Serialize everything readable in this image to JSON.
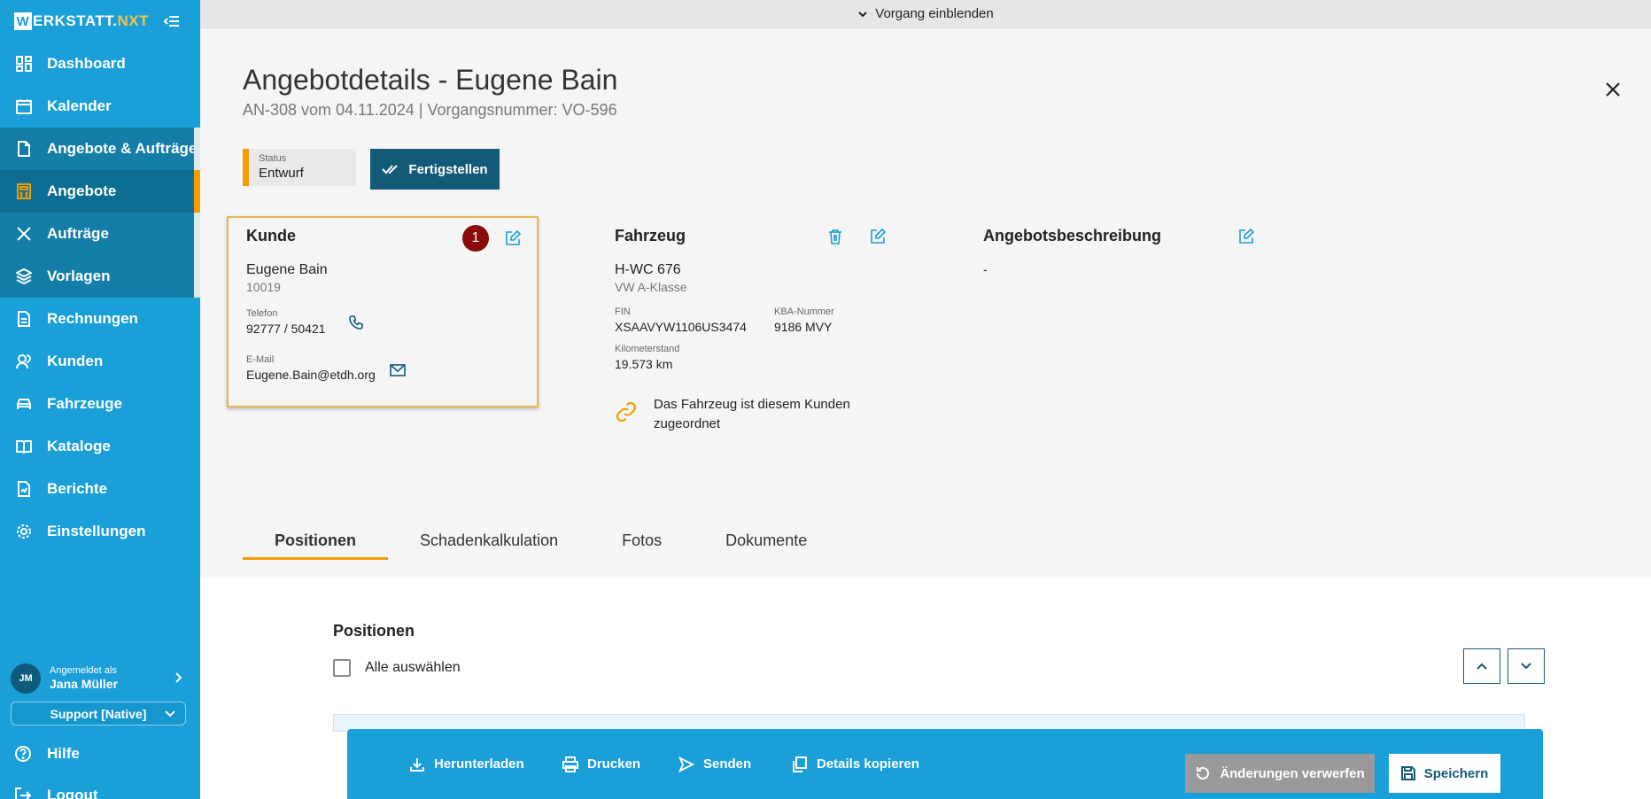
{
  "app": {
    "logo_w": "W",
    "logo_text": "ERKSTATT.",
    "logo_nxt": "NXT"
  },
  "sidebar": {
    "items": [
      {
        "label": "Dashboard",
        "icon": "dashboard-icon"
      },
      {
        "label": "Kalender",
        "icon": "calendar-icon"
      },
      {
        "label": "Angebote & Aufträge",
        "icon": "document-icon"
      },
      {
        "label": "Angebote",
        "icon": "calculator-icon"
      },
      {
        "label": "Aufträge",
        "icon": "tools-icon"
      },
      {
        "label": "Vorlagen",
        "icon": "layers-icon"
      },
      {
        "label": "Rechnungen",
        "icon": "invoice-icon"
      },
      {
        "label": "Kunden",
        "icon": "users-icon"
      },
      {
        "label": "Fahrzeuge",
        "icon": "car-icon"
      },
      {
        "label": "Kataloge",
        "icon": "book-icon"
      },
      {
        "label": "Berichte",
        "icon": "report-icon"
      },
      {
        "label": "Einstellungen",
        "icon": "gear-icon"
      }
    ],
    "user": {
      "initials": "JM",
      "logged_in_label": "Angemeldet als",
      "name": "Jana Müller"
    },
    "support_label": "Support [Native]",
    "help_label": "Hilfe",
    "logout_label": "Logout"
  },
  "topbar": {
    "label": "Vorgang einblenden"
  },
  "header": {
    "title": "Angebotdetails - Eugene Bain",
    "subtitle": "AN-308 vom 04.11.2024 | Vorgangsnummer: VO-596"
  },
  "status": {
    "label": "Status",
    "value": "Entwurf",
    "finish_button": "Fertigstellen"
  },
  "kunde": {
    "title": "Kunde",
    "badge": "1",
    "name": "Eugene Bain",
    "number": "10019",
    "phone_label": "Telefon",
    "phone": "92777 / 50421",
    "email_label": "E-Mail",
    "email": "Eugene.Bain@etdh.org"
  },
  "fahrzeug": {
    "title": "Fahrzeug",
    "plate": "H-WC 676",
    "model": "VW A-Klasse",
    "fin_label": "FIN",
    "fin": "XSAAVYW1106US3474",
    "kba_label": "KBA-Nummer",
    "kba": "9186 MVY",
    "km_label": "Kilometerstand",
    "km": "19.573 km",
    "link_note_line1": "Das Fahrzeug ist diesem Kunden",
    "link_note_line2": "zugeordnet"
  },
  "beschreibung": {
    "title": "Angebotsbeschreibung",
    "value": "-"
  },
  "tabs": [
    {
      "label": "Positionen"
    },
    {
      "label": "Schadenkalkulation"
    },
    {
      "label": "Fotos"
    },
    {
      "label": "Dokumente"
    }
  ],
  "positionen": {
    "title": "Positionen",
    "select_all": "Alle auswählen"
  },
  "actions": {
    "download": "Herunterladen",
    "print": "Drucken",
    "send": "Senden",
    "copy": "Details kopieren",
    "discard": "Änderungen verwerfen",
    "save": "Speichern"
  },
  "colors": {
    "sidebar": "#1a9fd9",
    "accent": "#f59c00",
    "primary_dark": "#135a78",
    "badge": "#8b0a0a"
  }
}
